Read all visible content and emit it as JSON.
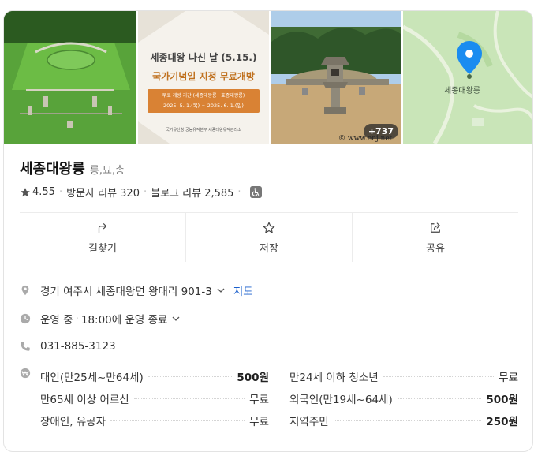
{
  "gallery": {
    "poster_line1": "세종대왕 나신 날 (5.15.)",
    "poster_line2": "국가기념일 지정 무료개방",
    "poster_box_line1": "무료 개방 기간 (세종대왕릉 · 효종대왕릉)",
    "poster_box_line2": "2025. 5. 1.(목) ~ 2025. 6. 1.(일)",
    "poster_footer": "국가유산청 궁능유적본부 세종대왕유적관리소",
    "more_count": "+737",
    "watermark": "© www.enj.net",
    "map_label": "세종대왕릉"
  },
  "place": {
    "name": "세종대왕릉",
    "category": "릉,묘,총",
    "rating": "4.55",
    "visitor_reviews": "방문자 리뷰 320",
    "blog_reviews": "블로그 리뷰 2,585"
  },
  "actions": [
    {
      "label": "길찾기"
    },
    {
      "label": "저장"
    },
    {
      "label": "공유"
    }
  ],
  "info": {
    "address": "경기 여주시 세종대왕면 왕대리 901-3",
    "map_link": "지도",
    "status": "운영 중",
    "close_time": "18:00에 운영 종료",
    "phone": "031-885-3123"
  },
  "fees": [
    [
      {
        "label": "대인(만25세~만64세)",
        "value": "500원",
        "bold": true
      },
      {
        "label": "만24세 이하 청소년",
        "value": "무료",
        "bold": false
      }
    ],
    [
      {
        "label": "만65세 이상 어르신",
        "value": "무료",
        "bold": false
      },
      {
        "label": "외국인(만19세~64세)",
        "value": "500원",
        "bold": true
      }
    ],
    [
      {
        "label": "장애인, 유공자",
        "value": "무료",
        "bold": false
      },
      {
        "label": "지역주민",
        "value": "250원",
        "bold": true
      }
    ]
  ],
  "colors": {
    "link": "#1a5fcc",
    "map_pin": "#1a8cf0",
    "poster_accent": "#d98234"
  }
}
